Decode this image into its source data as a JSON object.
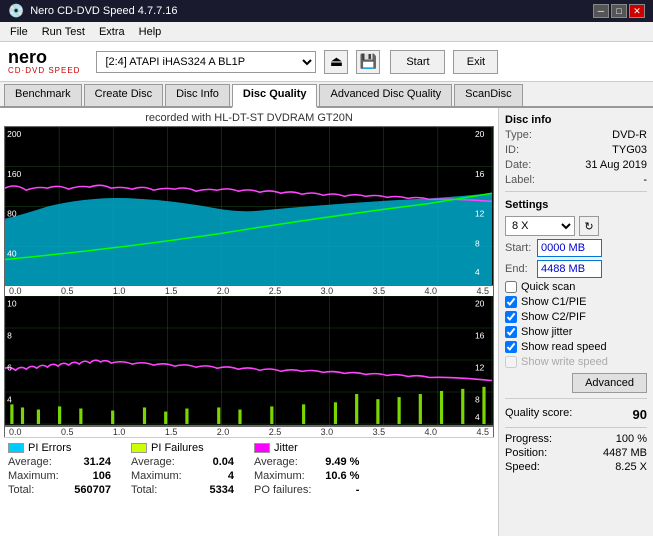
{
  "titleBar": {
    "title": "Nero CD-DVD Speed 4.7.7.16",
    "controls": [
      "minimize",
      "maximize",
      "close"
    ]
  },
  "menuBar": {
    "items": [
      "File",
      "Run Test",
      "Extra",
      "Help"
    ]
  },
  "header": {
    "logo": "nero",
    "subtext": "CD·DVD SPEED",
    "driveLabel": "[2:4]  ATAPI iHAS324  A BL1P",
    "startButton": "Start",
    "exitButton": "Exit"
  },
  "tabs": [
    {
      "id": "benchmark",
      "label": "Benchmark"
    },
    {
      "id": "create-disc",
      "label": "Create Disc"
    },
    {
      "id": "disc-info",
      "label": "Disc Info"
    },
    {
      "id": "disc-quality",
      "label": "Disc Quality",
      "active": true
    },
    {
      "id": "advanced-disc-quality",
      "label": "Advanced Disc Quality"
    },
    {
      "id": "scandisc",
      "label": "ScanDisc"
    }
  ],
  "chart": {
    "title": "recorded with HL-DT-ST DVDRAM GT20N",
    "upperYAxisLeft": [
      "200",
      "160",
      "80",
      "40"
    ],
    "upperYAxisRight": [
      "20",
      "16",
      "12",
      "8",
      "4"
    ],
    "lowerYAxisLeft": [
      "10",
      "8",
      "6",
      "4",
      "2"
    ],
    "lowerYAxisRight": [
      "20",
      "16",
      "12",
      "8",
      "4"
    ],
    "xAxisLabels": [
      "0.0",
      "0.5",
      "1.0",
      "1.5",
      "2.0",
      "2.5",
      "3.0",
      "3.5",
      "4.0",
      "4.5"
    ]
  },
  "legend": {
    "piErrors": {
      "label": "PI Errors",
      "color": "#00ccff",
      "average": "31.24",
      "maximum": "106",
      "total": "560707"
    },
    "piFailures": {
      "label": "PI Failures",
      "color": "#ccff00",
      "average": "0.04",
      "maximum": "4",
      "total": "5334"
    },
    "jitter": {
      "label": "Jitter",
      "color": "#ff00ff",
      "average": "9.49 %",
      "maximum": "10.6 %",
      "po_failures": "-"
    }
  },
  "rightPanel": {
    "discInfoTitle": "Disc info",
    "typeLabel": "Type:",
    "typeValue": "DVD-R",
    "idLabel": "ID:",
    "idValue": "TYG03",
    "dateLabel": "Date:",
    "dateValue": "31 Aug 2019",
    "labelLabel": "Label:",
    "labelValue": "-",
    "settingsTitle": "Settings",
    "speedLabel": "8 X",
    "startLabel": "Start:",
    "startValue": "0000 MB",
    "endLabel": "End:",
    "endValue": "4488 MB",
    "checkboxes": [
      {
        "id": "quick-scan",
        "label": "Quick scan",
        "checked": false
      },
      {
        "id": "show-c1pie",
        "label": "Show C1/PIE",
        "checked": true
      },
      {
        "id": "show-c2pif",
        "label": "Show C2/PIF",
        "checked": true
      },
      {
        "id": "show-jitter",
        "label": "Show jitter",
        "checked": true
      },
      {
        "id": "show-read-speed",
        "label": "Show read speed",
        "checked": true
      },
      {
        "id": "show-write-speed",
        "label": "Show write speed",
        "checked": false,
        "disabled": true
      }
    ],
    "advancedButton": "Advanced",
    "qualityScoreLabel": "Quality score:",
    "qualityScoreValue": "90",
    "progressLabel": "Progress:",
    "progressValue": "100 %",
    "positionLabel": "Position:",
    "positionValue": "4487 MB",
    "speedLabel2": "Speed:",
    "speedValue": "8.25 X"
  }
}
